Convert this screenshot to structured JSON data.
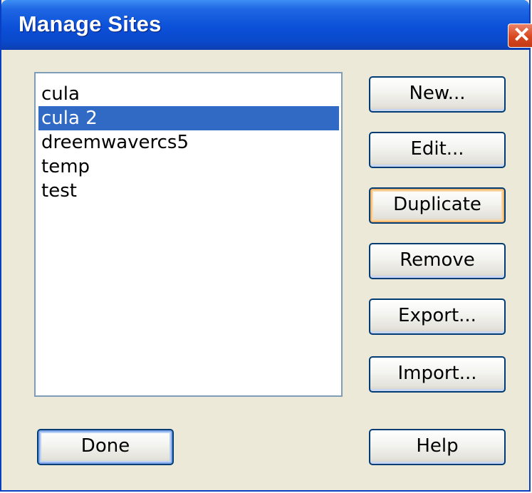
{
  "window": {
    "title": "Manage Sites",
    "close_glyph": "✕"
  },
  "sites": {
    "items": [
      {
        "label": "cula"
      },
      {
        "label": "cula 2",
        "selected": true
      },
      {
        "label": "dreemwavercs5"
      },
      {
        "label": "temp"
      },
      {
        "label": "test"
      }
    ]
  },
  "buttons": {
    "new_label": "New...",
    "edit_label": "Edit...",
    "duplicate_label": "Duplicate",
    "remove_label": "Remove",
    "export_label": "Export...",
    "import_label": "Import...",
    "done_label": "Done",
    "help_label": "Help"
  },
  "colors": {
    "title_bar": "#0b50d8",
    "selection": "#316ac5",
    "dialog_bg": "#ece9d8",
    "close_button": "#d9471f"
  }
}
